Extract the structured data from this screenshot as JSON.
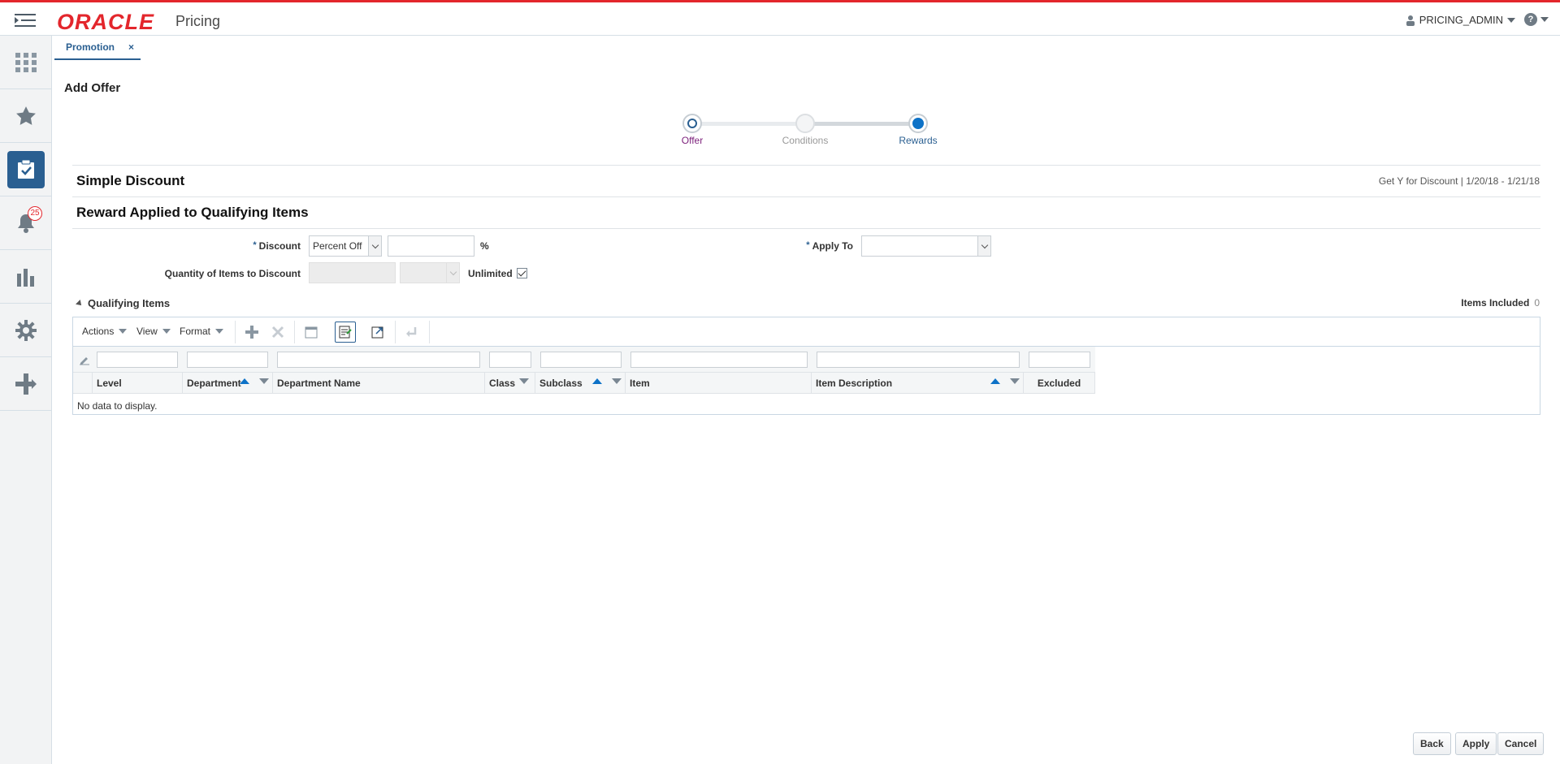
{
  "header": {
    "brand": "ORACLE",
    "product": "Pricing",
    "user": "PRICING_ADMIN",
    "help_icon": "question-icon"
  },
  "nav": {
    "items": [
      "apps-grid-icon",
      "star-icon",
      "task-clipboard-icon",
      "bell-icon",
      "bar-chart-icon",
      "gear-icon",
      "plus-arrow-icon"
    ],
    "notification_count": "25"
  },
  "tabs": [
    {
      "label": "Promotion",
      "close": "×"
    }
  ],
  "page": {
    "title": "Add Offer"
  },
  "train": {
    "stops": [
      "Offer",
      "Conditions",
      "Rewards"
    ],
    "colors": {
      "offer": "#7b1f7a",
      "conditions": "#999999",
      "rewards": "#2a5f91"
    }
  },
  "section": {
    "title": "Simple Discount",
    "info": "Get Y for Discount |  1/20/18  -  1/21/18",
    "reward_title": "Reward Applied to Qualifying Items"
  },
  "form": {
    "discount_label": "Discount",
    "discount_type": "Percent Off",
    "discount_value": "",
    "percent": "%",
    "apply_to_label": "Apply To",
    "apply_to_value": "",
    "qty_label": "Quantity of Items to Discount",
    "unlimited_label": "Unlimited",
    "unlimited_checked": true,
    "required_mark": "*"
  },
  "qualifying": {
    "title": "Qualifying Items",
    "items_included_label": "Items Included",
    "items_included_count": "0",
    "toolbar": {
      "actions": "Actions",
      "view": "View",
      "format": "Format"
    },
    "columns": [
      "Level",
      "Department",
      "Department Name",
      "Class",
      "Subclass",
      "Item",
      "Item Description",
      "Excluded"
    ],
    "empty": "No data to display."
  },
  "footer": {
    "back": "Back",
    "apply": "Apply",
    "cancel": "Cancel"
  }
}
